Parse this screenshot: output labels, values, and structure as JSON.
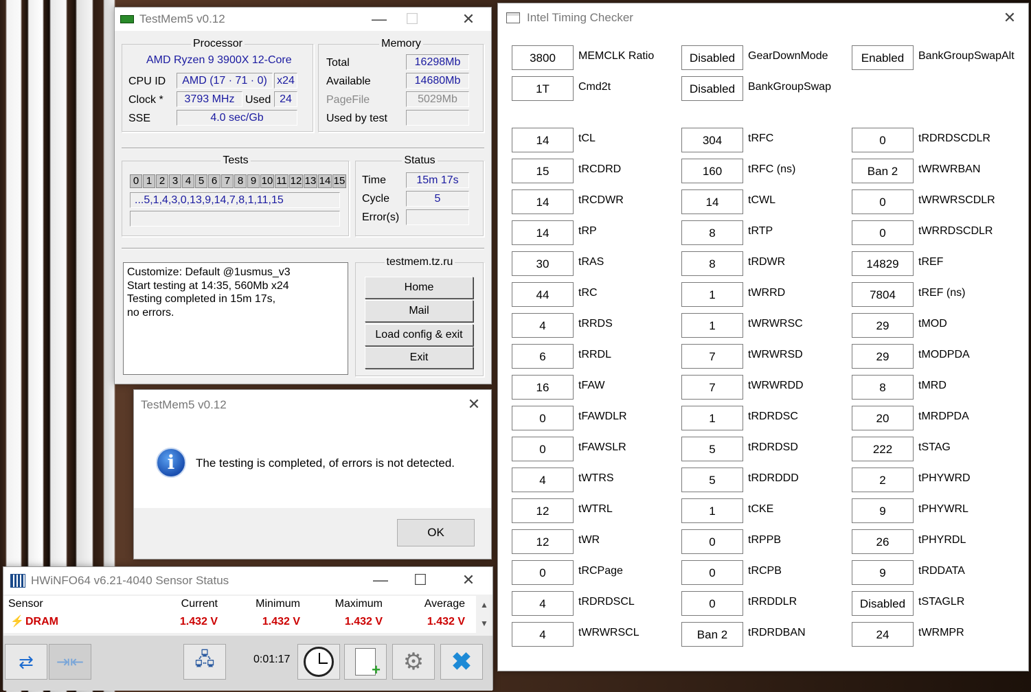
{
  "testmem": {
    "title": "TestMem5 v0.12",
    "processor": {
      "legend": "Processor",
      "name": "AMD Ryzen 9 3900X 12-Core",
      "cpuid_label": "CPU ID",
      "cpuid": "AMD  (17 · 71 · 0)",
      "threads_x": "x24",
      "clock_label": "Clock *",
      "clock": "3793 MHz",
      "used_label": "Used",
      "used": "24",
      "sse_label": "SSE",
      "sse": "4.0 sec/Gb"
    },
    "memory": {
      "legend": "Memory",
      "total_label": "Total",
      "total": "16298Mb",
      "available_label": "Available",
      "available": "14680Mb",
      "pagefile_label": "PageFile",
      "pagefile": "5029Mb",
      "usedbytest_label": "Used by test",
      "usedbytest": ""
    },
    "tests": {
      "legend": "Tests",
      "numbers": [
        "0",
        "1",
        "2",
        "3",
        "4",
        "5",
        "6",
        "7",
        "8",
        "9",
        "10",
        "11",
        "12",
        "13",
        "14",
        "15"
      ],
      "sequence": "...5,1,4,3,0,13,9,14,7,8,1,11,15",
      "extra": ""
    },
    "status": {
      "legend": "Status",
      "time_label": "Time",
      "time": "15m 17s",
      "cycle_label": "Cycle",
      "cycle": "5",
      "errors_label": "Error(s)",
      "errors": ""
    },
    "log": [
      "Customize: Default @1usmus_v3",
      "Start testing at 14:35, 560Mb x24",
      "Testing completed in 15m 17s,",
      "no errors."
    ],
    "site": {
      "legend": "testmem.tz.ru",
      "home": "Home",
      "mail": "Mail",
      "load": "Load config & exit",
      "exit": "Exit"
    }
  },
  "dialog": {
    "title": "TestMem5 v0.12",
    "message": "The testing is completed, of errors is not detected.",
    "ok": "OK"
  },
  "hwinfo": {
    "title": "HWiNFO64 v6.21-4040 Sensor Status",
    "columns": [
      "Sensor",
      "Current",
      "Minimum",
      "Maximum",
      "Average"
    ],
    "row": {
      "name": "DRAM",
      "current": "1.432 V",
      "minimum": "1.432 V",
      "maximum": "1.432 V",
      "average": "1.432 V"
    },
    "elapsed": "0:01:17",
    "colors": {
      "value_red": "#cc0000",
      "close_blue": "#1d8ad6"
    }
  },
  "itc": {
    "title": "Intel Timing Checker",
    "top": [
      {
        "v": "3800",
        "l": "MEMCLK Ratio"
      },
      {
        "v": "Disabled",
        "l": "GearDownMode"
      },
      {
        "v": "Enabled",
        "l": "BankGroupSwapAlt"
      },
      {
        "v": "1T",
        "l": "Cmd2t"
      },
      {
        "v": "Disabled",
        "l": "BankGroupSwap"
      }
    ],
    "col1": [
      {
        "v": "14",
        "l": "tCL"
      },
      {
        "v": "15",
        "l": "tRCDRD"
      },
      {
        "v": "14",
        "l": "tRCDWR"
      },
      {
        "v": "14",
        "l": "tRP"
      },
      {
        "v": "30",
        "l": "tRAS"
      },
      {
        "v": "44",
        "l": "tRC"
      },
      {
        "v": "4",
        "l": "tRRDS"
      },
      {
        "v": "6",
        "l": "tRRDL"
      },
      {
        "v": "16",
        "l": "tFAW"
      },
      {
        "v": "0",
        "l": "tFAWDLR"
      },
      {
        "v": "0",
        "l": "tFAWSLR"
      },
      {
        "v": "4",
        "l": "tWTRS"
      },
      {
        "v": "12",
        "l": "tWTRL"
      },
      {
        "v": "12",
        "l": "tWR"
      },
      {
        "v": "0",
        "l": "tRCPage"
      },
      {
        "v": "4",
        "l": "tRDRDSCL"
      },
      {
        "v": "4",
        "l": "tWRWRSCL"
      }
    ],
    "col2": [
      {
        "v": "304",
        "l": "tRFC"
      },
      {
        "v": "160",
        "l": "tRFC (ns)"
      },
      {
        "v": "14",
        "l": "tCWL"
      },
      {
        "v": "8",
        "l": "tRTP"
      },
      {
        "v": "8",
        "l": "tRDWR"
      },
      {
        "v": "1",
        "l": "tWRRD"
      },
      {
        "v": "1",
        "l": "tWRWRSC"
      },
      {
        "v": "7",
        "l": "tWRWRSD"
      },
      {
        "v": "7",
        "l": "tWRWRDD"
      },
      {
        "v": "1",
        "l": "tRDRDSC"
      },
      {
        "v": "5",
        "l": "tRDRDSD"
      },
      {
        "v": "5",
        "l": "tRDRDDD"
      },
      {
        "v": "1",
        "l": "tCKE"
      },
      {
        "v": "0",
        "l": "tRPPB"
      },
      {
        "v": "0",
        "l": "tRCPB"
      },
      {
        "v": "0",
        "l": "tRRDDLR"
      },
      {
        "v": "Ban 2",
        "l": "tRDRDBAN"
      }
    ],
    "col3": [
      {
        "v": "0",
        "l": "tRDRDSCDLR"
      },
      {
        "v": "Ban 2",
        "l": "tWRWRBAN"
      },
      {
        "v": "0",
        "l": "tWRWRSCDLR"
      },
      {
        "v": "0",
        "l": "tWRRDSCDLR"
      },
      {
        "v": "14829",
        "l": "tREF"
      },
      {
        "v": "7804",
        "l": "tREF (ns)"
      },
      {
        "v": "29",
        "l": "tMOD"
      },
      {
        "v": "29",
        "l": "tMODPDA"
      },
      {
        "v": "8",
        "l": "tMRD"
      },
      {
        "v": "20",
        "l": "tMRDPDA"
      },
      {
        "v": "222",
        "l": "tSTAG"
      },
      {
        "v": "2",
        "l": "tPHYWRD"
      },
      {
        "v": "9",
        "l": "tPHYWRL"
      },
      {
        "v": "26",
        "l": "tPHYRDL"
      },
      {
        "v": "9",
        "l": "tRDDATA"
      },
      {
        "v": "Disabled",
        "l": "tSTAGLR"
      },
      {
        "v": "24",
        "l": "tWRMPR"
      }
    ]
  }
}
